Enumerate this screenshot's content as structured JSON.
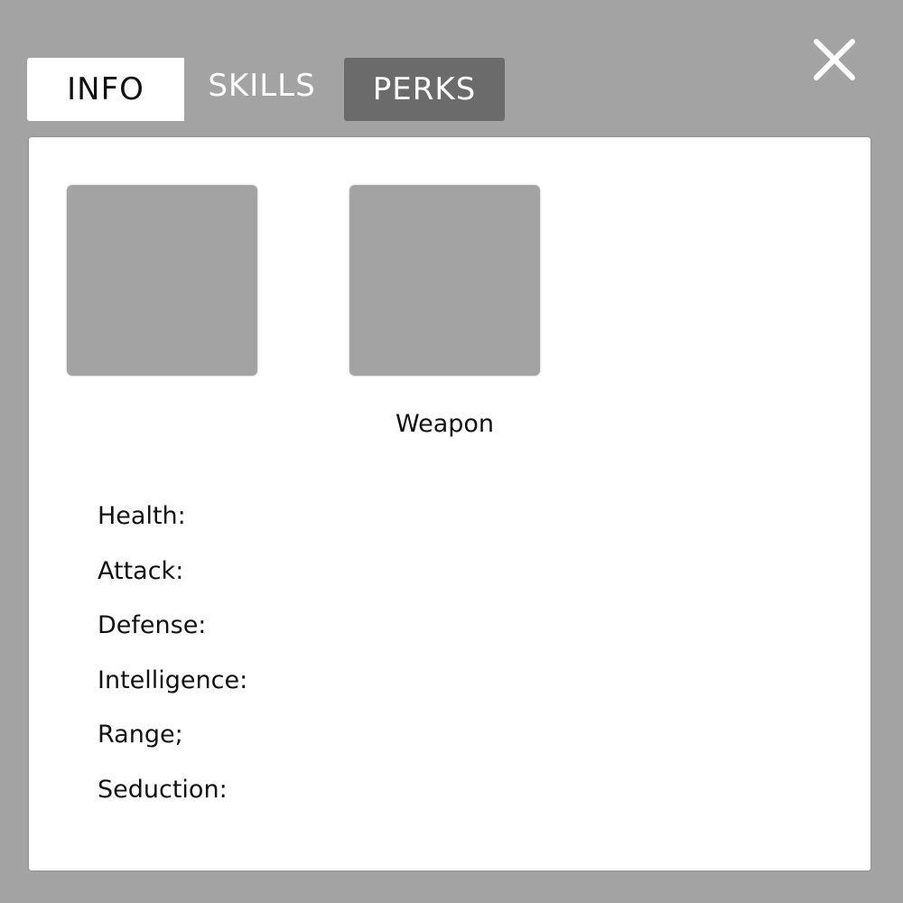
{
  "tabs": {
    "info": "INFO",
    "skills": "SKILLS",
    "perks": "PERKS"
  },
  "close_icon": "close-x-icon",
  "slots": {
    "slot_1_label": "",
    "slot_2_label": "Weapon"
  },
  "stats": [
    "Health:",
    "Attack:",
    "Defense:",
    "Intelligence:",
    "Range;",
    "Seduction:"
  ],
  "colors": {
    "background": "#a3a3a3",
    "panel": "#ffffff",
    "active_tab": "#ffffff",
    "perks_tab": "#6b6b6b",
    "slot": "#a3a3a3"
  }
}
